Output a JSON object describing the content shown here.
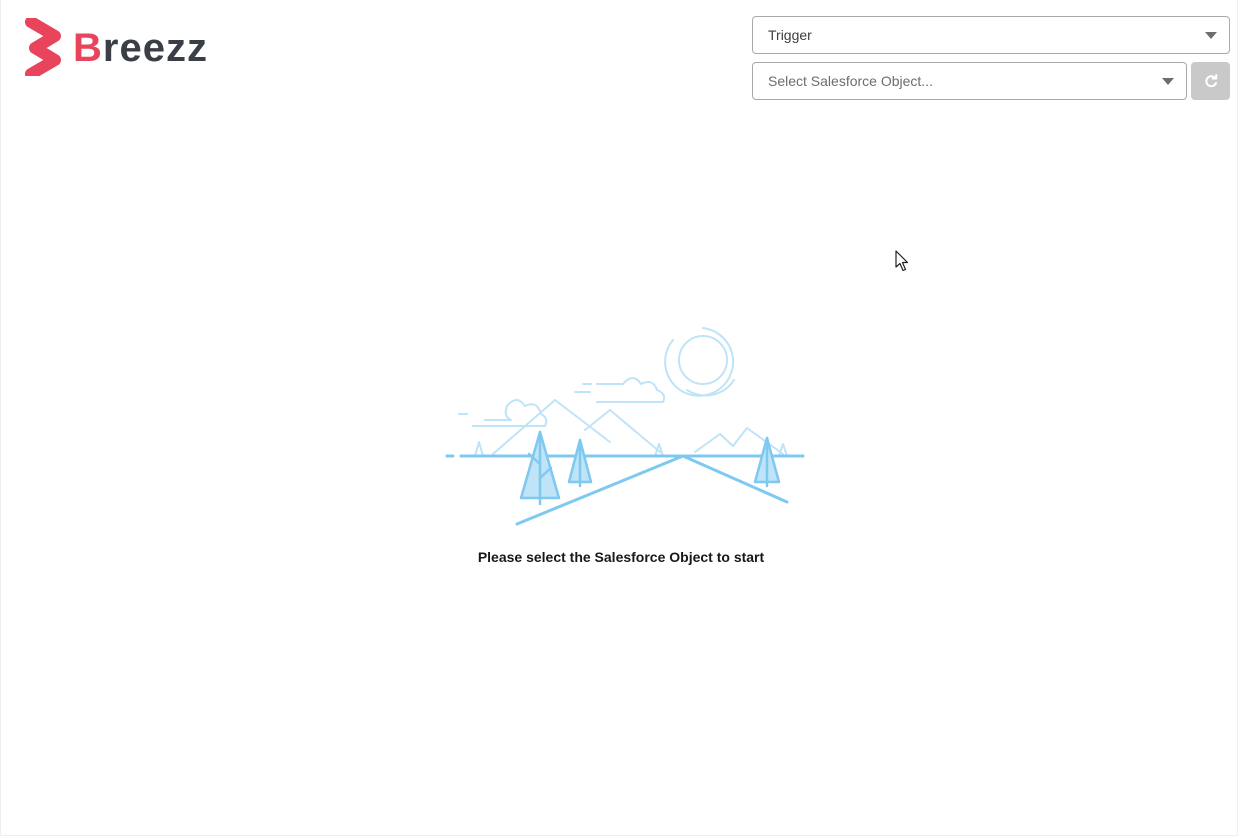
{
  "brand": {
    "name_accent": "B",
    "name_rest": "reezz",
    "logo_icon": "breezz-logo-icon",
    "accent_color": "#e8445c"
  },
  "controls": {
    "trigger_select": {
      "value": "Trigger",
      "icon": "chevron-down-icon"
    },
    "object_select": {
      "placeholder": "Select Salesforce Object...",
      "icon": "chevron-down-icon"
    },
    "refresh_button": {
      "icon": "refresh-icon",
      "disabled": true
    }
  },
  "empty_state": {
    "illustration": "landscape-mountains-trees-sun-icon",
    "message": "Please select the Salesforce Object to start"
  },
  "colors": {
    "illustration_stroke": "#7fc9f1",
    "illustration_fill": "#bfe3f7",
    "border": "#a9a9a9",
    "disabled_button": "#c9c9c9"
  }
}
